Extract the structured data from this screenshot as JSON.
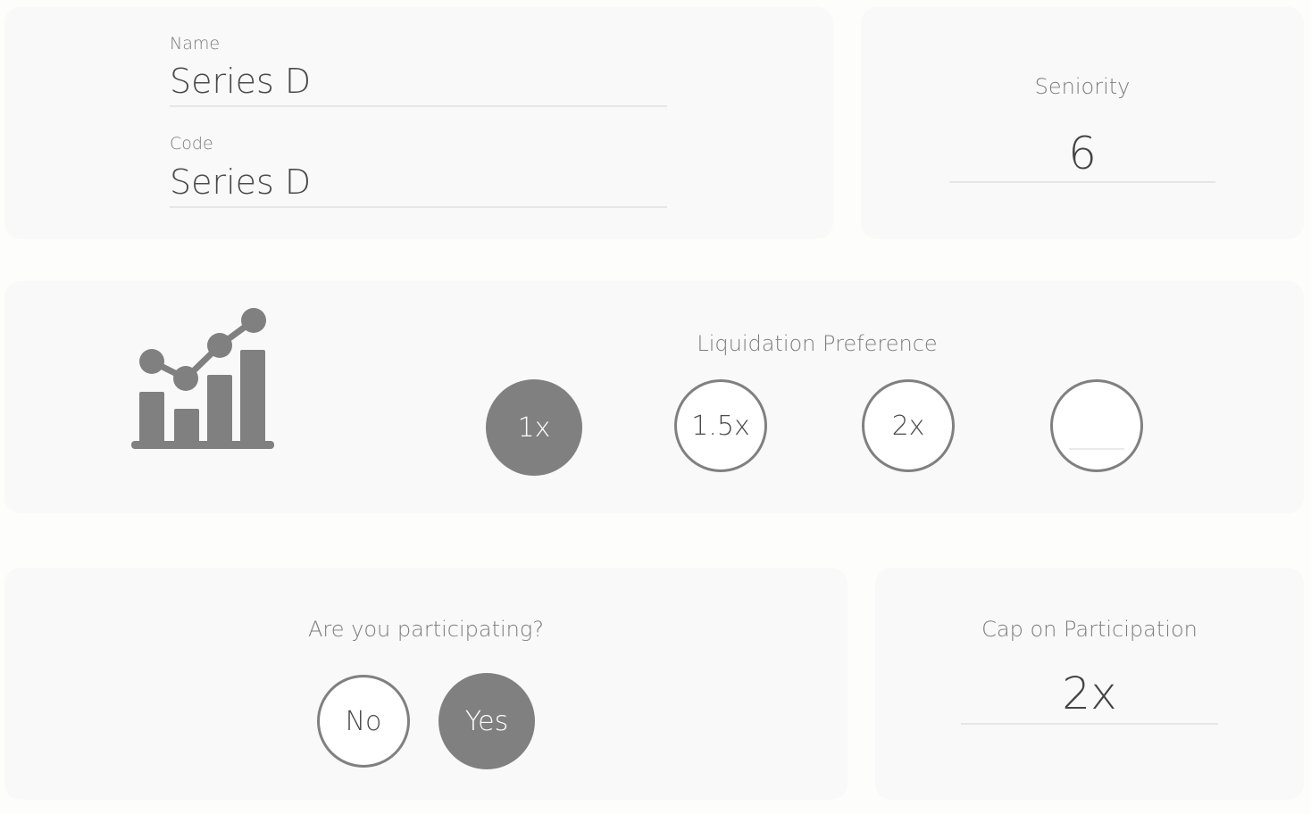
{
  "identity": {
    "name_label": "Name",
    "name_value": "Series D",
    "code_label": "Code",
    "code_value": "Series D"
  },
  "seniority": {
    "label": "Seniority",
    "value": "6"
  },
  "liquidation": {
    "label": "Liquidation Preference",
    "options": [
      "1x",
      "1.5x",
      "2x"
    ],
    "selected": "1x",
    "custom_value": ""
  },
  "participating": {
    "question": "Are you participating?",
    "no_label": "No",
    "yes_label": "Yes",
    "selected": "Yes"
  },
  "cap": {
    "label": "Cap on Participation",
    "value": "2x"
  },
  "colors": {
    "accent": "#808080",
    "card_bg": "#f9f9f9"
  },
  "icons": {
    "liquidation_icon": "bar-line-chart-icon"
  }
}
